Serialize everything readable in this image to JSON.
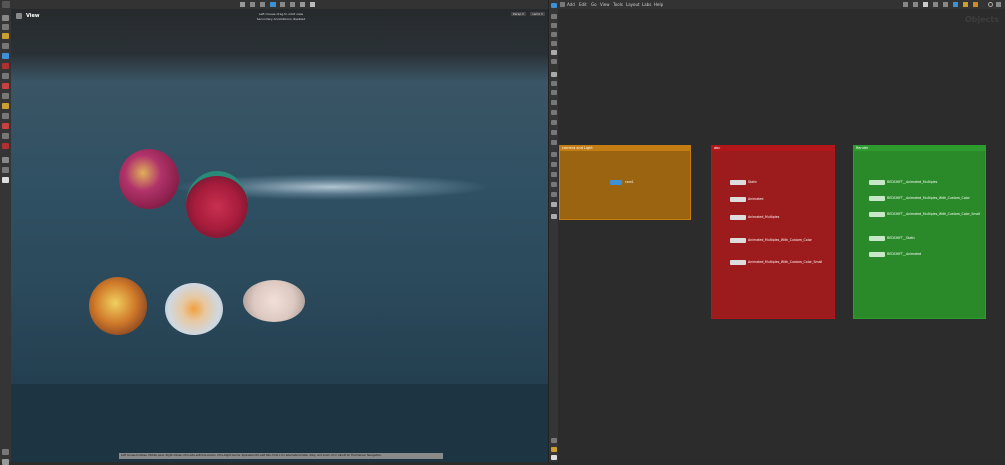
{
  "viewport": {
    "title": "View",
    "hint_line1": "Left mouse drag to orbit view",
    "hint_line2": "Secondary Annotations disabled",
    "persp_label": "Persp ▾",
    "cam_label": "cam1 ▾",
    "status_bar": "Left mouse tumbles. Middle pans. Right dollies. Ctrl+Alt+Left box-zooms. Ctrl+Right zooms. Spacebar-Ctrl-Left tilts. Hold L for alternate tumble, dolly, and zoom. M or Alt+M for First Person Navigation."
  },
  "network": {
    "menu": [
      "Add",
      "Edit",
      "Go",
      "View",
      "Tools",
      "Layout",
      "Labs",
      "Help"
    ],
    "watermark": "Objects",
    "boxes": [
      {
        "title": "camera and Light",
        "color": "#c47d12",
        "nodes": [
          {
            "label": "cam1"
          }
        ]
      },
      {
        "title": "abc",
        "color": "#b3161a",
        "nodes": [
          {
            "label": "Static"
          },
          {
            "label": "Animated"
          },
          {
            "label": "Animated_Multiples"
          },
          {
            "label": "Animated_Multiples_With_Custom_Color"
          },
          {
            "label": "Animated_Multiples_With_Custom_Color_Small"
          }
        ]
      },
      {
        "title": "Render",
        "color": "#2e9b2e",
        "nodes": [
          {
            "label": "REDSHIFT__Animated_Multiples"
          },
          {
            "label": "REDSHIFT__Animated_Multiples_With_Custom_Color"
          },
          {
            "label": "REDSHIFT__Animated_Multiples_With_Custom_Color_Small"
          },
          {
            "label": "REDSHIFT__Static"
          },
          {
            "label": "REDSHIFT__Animated"
          }
        ]
      }
    ]
  },
  "colors": {
    "accent_blue": "#3d8fd6",
    "box_orange": "#c47d12",
    "box_red": "#b3161a",
    "box_green": "#2e9b2e"
  }
}
